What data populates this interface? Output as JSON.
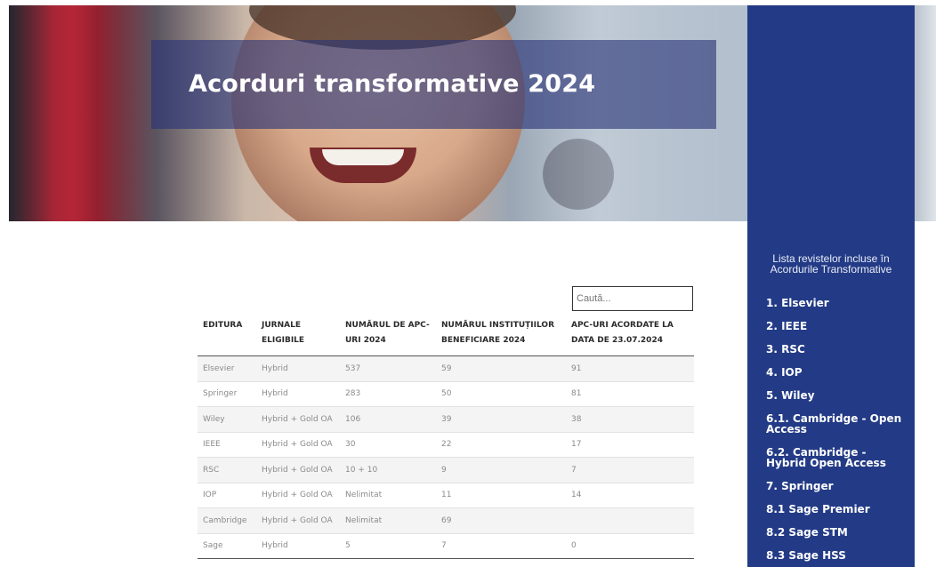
{
  "hero": {
    "title": "Acorduri transformative 2024"
  },
  "sidebar": {
    "heading": "Lista revistelor incluse în Acordurile Transformative",
    "items": [
      {
        "label": "1. Elsevier"
      },
      {
        "label": "2. IEEE"
      },
      {
        "label": "3. RSC"
      },
      {
        "label": "4. IOP"
      },
      {
        "label": "5. Wiley"
      },
      {
        "label": "6.1.  Cambridge  -  Open Access"
      },
      {
        "label": "6.2. Cambridge - Hybrid Open Access"
      },
      {
        "label": "7. Springer"
      },
      {
        "label": "8.1 Sage Premier"
      },
      {
        "label": "8.2 Sage STM"
      },
      {
        "label": "8.3 Sage HSS"
      }
    ]
  },
  "search": {
    "placeholder": "Caută..."
  },
  "table": {
    "headers": [
      "EDITURA",
      "JURNALE ELIGIBILE",
      "NUMĂRUL DE APC-URI 2024",
      "NUMĂRUL INSTITUȚIILOR BENEFICIARE 2024",
      "APC-URI ACORDATE LA DATA DE 23.07.2024"
    ],
    "rows": [
      [
        "Elsevier",
        "Hybrid",
        "537",
        "59",
        "91"
      ],
      [
        "Springer",
        "Hybrid",
        "283",
        "50",
        "81"
      ],
      [
        "Wiley",
        "Hybrid + Gold OA",
        "106",
        "39",
        "38"
      ],
      [
        "IEEE",
        "Hybrid + Gold OA",
        "30",
        "22",
        "17"
      ],
      [
        "RSC",
        "Hybrid + Gold OA",
        "10 + 10",
        "9",
        "7"
      ],
      [
        "IOP",
        "Hybrid + Gold OA",
        "Nelimitat",
        "11",
        "14"
      ],
      [
        "Cambridge",
        "Hybrid + Gold OA",
        "Nelimitat",
        "69",
        ""
      ],
      [
        "Sage",
        "Hybrid",
        "5",
        "7",
        "0"
      ]
    ]
  }
}
